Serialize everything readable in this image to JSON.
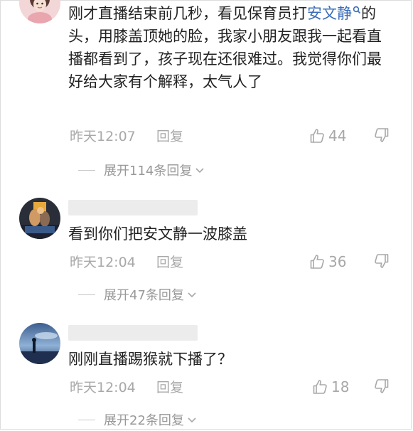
{
  "comments": [
    {
      "text_before": "刚才直播结束前几秒，看见保育员打",
      "mention": "安文静",
      "text_after": "的头，用膝盖顶她的脸，我家小朋友跟我一起看直播都看到了，孩子现在还很难过。我觉得你们最好给大家有个解释，太气人了",
      "timestamp": "昨天12:07",
      "reply_label": "回复",
      "likes": "44",
      "expand_label": "展开114条回复"
    },
    {
      "text": "看到你们把安文静一波膝盖",
      "timestamp": "昨天12:04",
      "reply_label": "回复",
      "likes": "36",
      "expand_label": "展开47条回复"
    },
    {
      "text": "刚刚直播踢猴就下播了？",
      "timestamp": "昨天12:04",
      "reply_label": "回复",
      "likes": "18",
      "expand_label": "展开22条回复"
    }
  ],
  "colors": {
    "mention": "#3b6cb7",
    "meta": "#a8a8a8",
    "text": "#222222"
  }
}
